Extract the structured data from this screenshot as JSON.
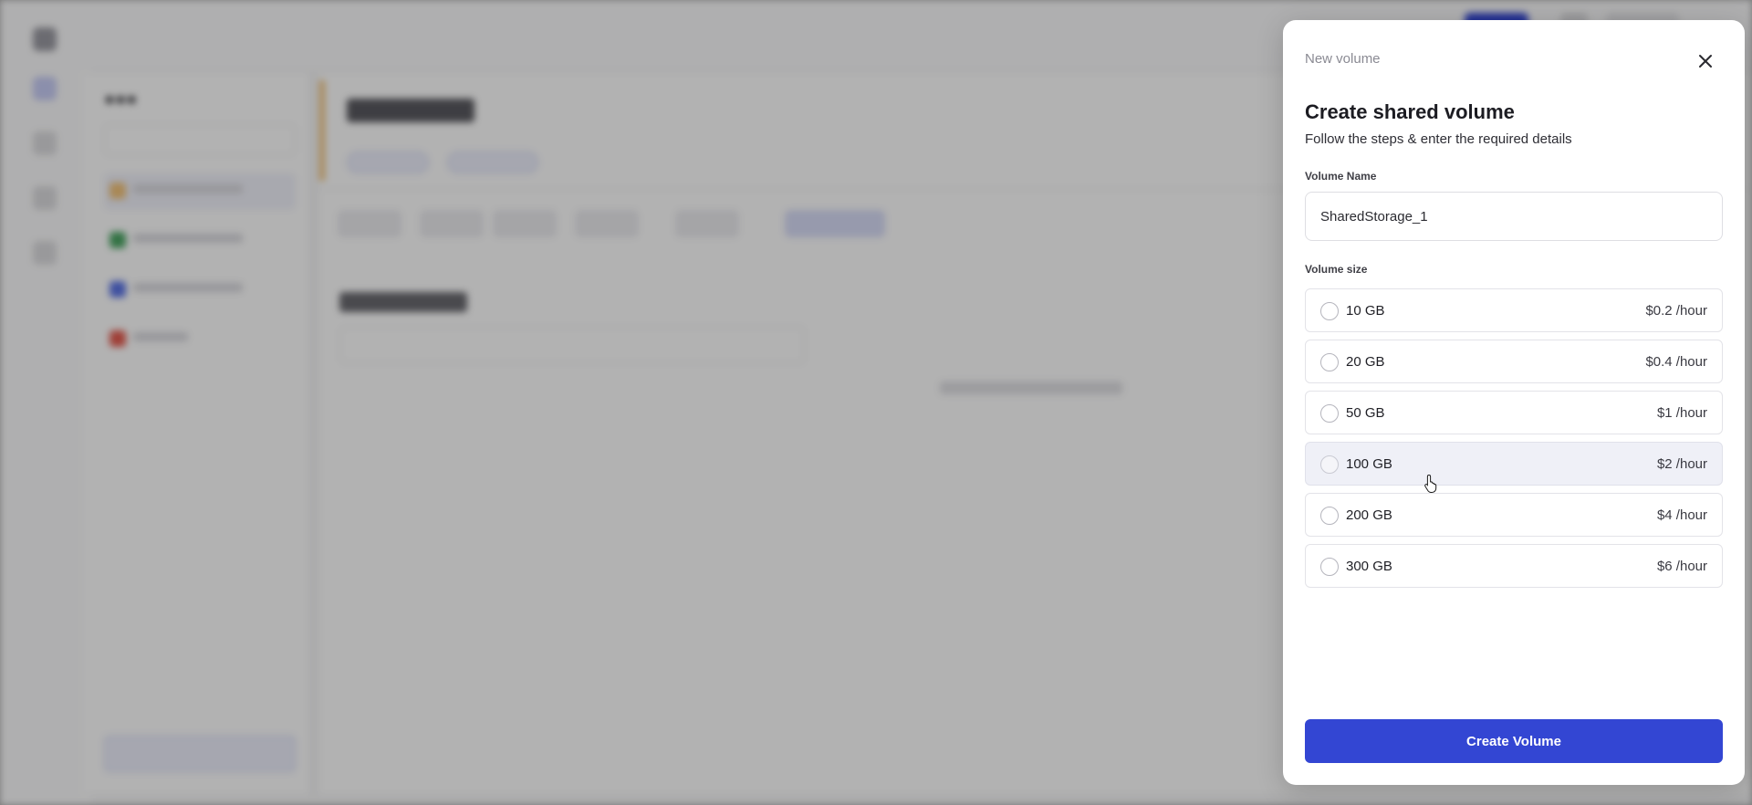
{
  "drawer": {
    "breadcrumb": "New volume",
    "title": "Create shared volume",
    "subtitle": "Follow the steps & enter the required details",
    "volume_name_label": "Volume Name",
    "volume_name_value": "SharedStorage_1",
    "volume_size_label": "Volume size",
    "options": [
      {
        "size": "10 GB",
        "price": "$0.2 /hour"
      },
      {
        "size": "20 GB",
        "price": "$0.4 /hour"
      },
      {
        "size": "50 GB",
        "price": "$1 /hour"
      },
      {
        "size": "100 GB",
        "price": "$2 /hour"
      },
      {
        "size": "200 GB",
        "price": "$4 /hour"
      },
      {
        "size": "300 GB",
        "price": "$6 /hour"
      }
    ],
    "hovered_option": "100 GB",
    "create_button": "Create Volume"
  },
  "colors": {
    "primary": "#3346d3",
    "overlay": "#ababab",
    "hover_row": "#eff0f7"
  },
  "icons": {
    "close": "close-icon",
    "cursor": "hand-pointer-icon"
  }
}
